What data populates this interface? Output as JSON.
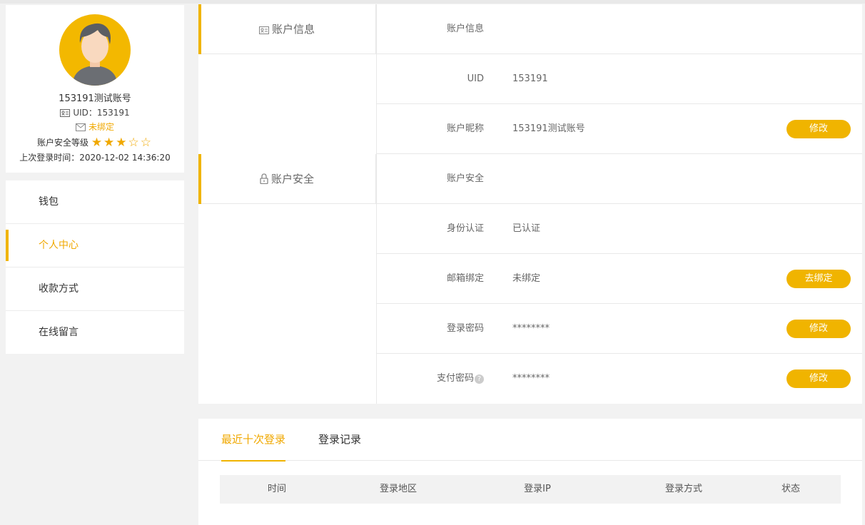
{
  "profile": {
    "name": "153191测试账号",
    "uid_text": "UID：153191",
    "bind_text": "未绑定",
    "level_label": "账户安全等级",
    "stars": "★★★☆☆",
    "last_login": "上次登录时间：2020-12-02 14:36:20"
  },
  "menu": {
    "items": [
      {
        "label": "钱包"
      },
      {
        "label": "个人中心"
      },
      {
        "label": "收款方式"
      },
      {
        "label": "在线留言"
      }
    ]
  },
  "sections": {
    "info_title": "账户信息",
    "security_title": "账户安全"
  },
  "rows": [
    {
      "label": "账户信息",
      "value": "",
      "button": ""
    },
    {
      "label": "UID",
      "value": "153191",
      "button": ""
    },
    {
      "label": "账户昵称",
      "value": "153191测试账号",
      "button": "修改"
    },
    {
      "label": "账户安全",
      "value": "",
      "button": ""
    },
    {
      "label": "身份认证",
      "value": "已认证",
      "button": ""
    },
    {
      "label": "邮箱绑定",
      "value": "未绑定",
      "button": "去绑定"
    },
    {
      "label": "登录密码",
      "value": "********",
      "button": "修改"
    },
    {
      "label": "支付密码",
      "value": "********",
      "button": "修改"
    }
  ],
  "records": {
    "tabs": [
      {
        "label": "最近十次登录"
      },
      {
        "label": "登录记录"
      }
    ],
    "columns": [
      "时间",
      "登录地区",
      "登录IP",
      "登录方式",
      "状态"
    ]
  },
  "colors": {
    "accent": "#f0b400",
    "accent_text": "#f0a800"
  }
}
